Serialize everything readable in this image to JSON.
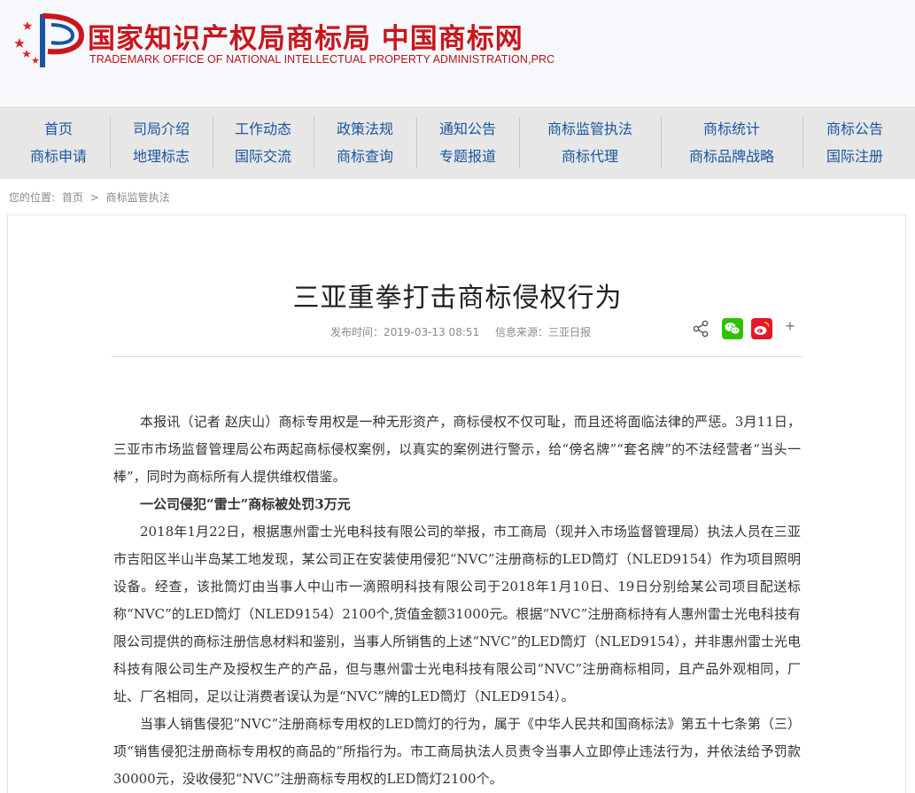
{
  "header": {
    "title_cn": "国家知识产权局商标局 中国商标网",
    "title_en": "TRADEMARK OFFICE OF NATIONAL INTELLECTUAL PROPERTY ADMINISTRATION,PRC",
    "logo_icon": "cnipa-logo-icon"
  },
  "nav": {
    "columns": [
      {
        "top": "首页",
        "bottom": "商标申请"
      },
      {
        "top": "司局介绍",
        "bottom": "地理标志"
      },
      {
        "top": "工作动态",
        "bottom": "国际交流"
      },
      {
        "top": "政策法规",
        "bottom": "商标查询"
      },
      {
        "top": "通知公告",
        "bottom": "专题报道"
      },
      {
        "top": "商标监管执法",
        "bottom": "商标代理"
      },
      {
        "top": "商标统计",
        "bottom": "商标品牌战略"
      },
      {
        "top": "商标公告",
        "bottom": "国际注册"
      }
    ]
  },
  "breadcrumb": {
    "label": "您的位置:",
    "home": "首页",
    "separator": ">",
    "current": "商标监管执法"
  },
  "article": {
    "title": "三亚重拳打击商标侵权行为",
    "publish_time": "发布时间：2019-03-13 08:51",
    "source": "信息来源：三亚日报",
    "share": {
      "icons": [
        "share-icon",
        "wechat-icon",
        "weibo-icon",
        "plus-icon"
      ],
      "plus_label": "+",
      "wechat_color": "#2dc100",
      "weibo_color": "#e6162d"
    },
    "paragraphs": [
      "本报讯（记者 赵庆山）商标专用权是一种无形资产，商标侵权不仅可耻，而且还将面临法律的严惩。3月11日，三亚市市场监督管理局公布两起商标侵权案例，以真实的案例进行警示，给“傍名牌”“套名牌”的不法经营者“当头一棒”，同时为商标所有人提供维权借鉴。",
      "一公司侵犯“雷士”商标被处罚3万元",
      "2018年1月22日，根据惠州雷士光电科技有限公司的举报，市工商局（现并入市场监督管理局）执法人员在三亚市吉阳区半山半岛某工地发现，某公司正在安装使用侵犯“NVC”注册商标的LED筒灯（NLED9154）作为项目照明设备。经查，该批筒灯由当事人中山市一滴照明科技有限公司于2018年1月10日、19日分别给某公司项目配送标称“NVC”的LED筒灯（NLED9154）2100个,货值金额31000元。根据“NVC”注册商标持有人惠州雷士光电科技有限公司提供的商标注册信息材料和鉴别，当事人所销售的上述“NVC”的LED筒灯（NLED9154），并非惠州雷士光电科技有限公司生产及授权生产的产品，但与惠州雷士光电科技有限公司“NVC”注册商标相同，且产品外观相同，厂址、厂名相同，足以让消费者误认为是“NVC”牌的LED筒灯（NLED9154）。",
      "当事人销售侵犯“NVC”注册商标专用权的LED筒灯的行为，属于《中华人民共和国商标法》第五十七条第（三）项“销售侵犯注册商标专用权的商品的”所指行为。市工商局执法人员责令当事人立即停止违法行为，并依法给予罚款30000元，没收侵犯“NVC”注册商标专用权的LED筒灯2100个。"
    ]
  }
}
